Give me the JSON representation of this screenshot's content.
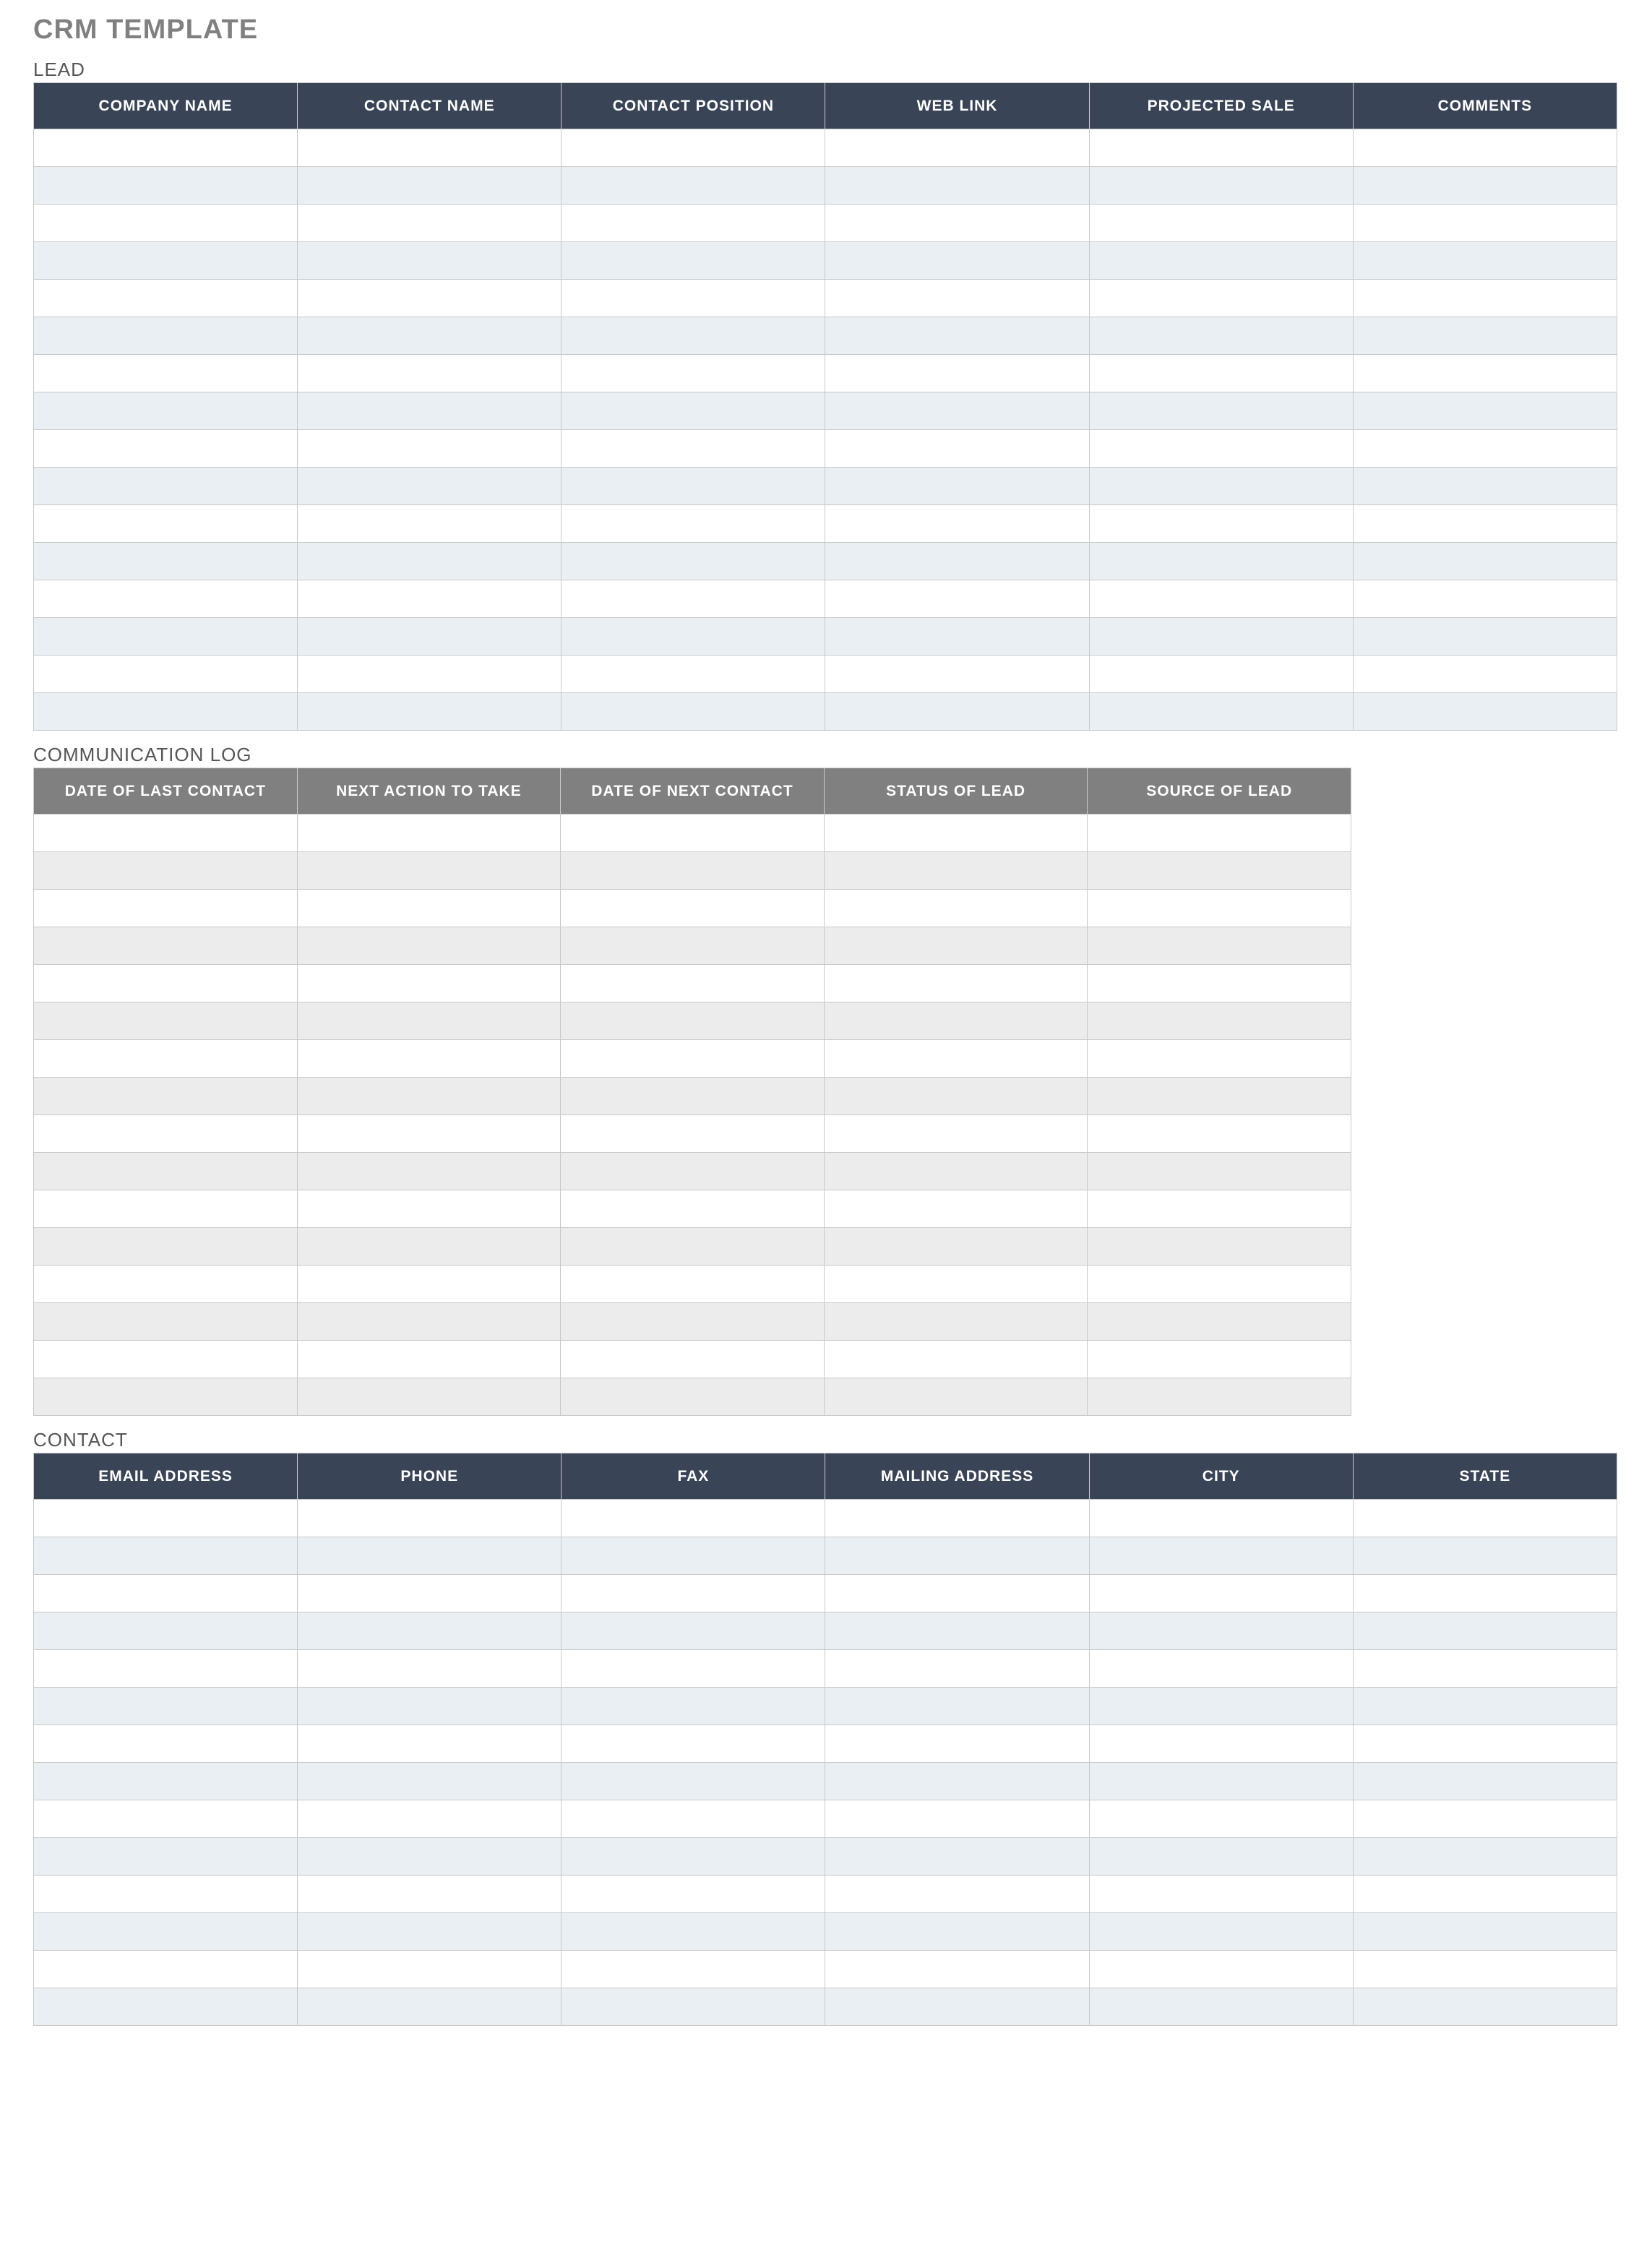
{
  "title": "CRM TEMPLATE",
  "lead": {
    "label": "LEAD",
    "headers": [
      "COMPANY NAME",
      "CONTACT NAME",
      "CONTACT POSITION",
      "WEB LINK",
      "PROJECTED SALE",
      "COMMENTS"
    ],
    "rows": [
      [
        "",
        "",
        "",
        "",
        "",
        ""
      ],
      [
        "",
        "",
        "",
        "",
        "",
        ""
      ],
      [
        "",
        "",
        "",
        "",
        "",
        ""
      ],
      [
        "",
        "",
        "",
        "",
        "",
        ""
      ],
      [
        "",
        "",
        "",
        "",
        "",
        ""
      ],
      [
        "",
        "",
        "",
        "",
        "",
        ""
      ],
      [
        "",
        "",
        "",
        "",
        "",
        ""
      ],
      [
        "",
        "",
        "",
        "",
        "",
        ""
      ],
      [
        "",
        "",
        "",
        "",
        "",
        ""
      ],
      [
        "",
        "",
        "",
        "",
        "",
        ""
      ],
      [
        "",
        "",
        "",
        "",
        "",
        ""
      ],
      [
        "",
        "",
        "",
        "",
        "",
        ""
      ],
      [
        "",
        "",
        "",
        "",
        "",
        ""
      ],
      [
        "",
        "",
        "",
        "",
        "",
        ""
      ],
      [
        "",
        "",
        "",
        "",
        "",
        ""
      ],
      [
        "",
        "",
        "",
        "",
        "",
        ""
      ]
    ]
  },
  "communication_log": {
    "label": "COMMUNICATION LOG",
    "headers": [
      "DATE OF LAST CONTACT",
      "NEXT ACTION TO TAKE",
      "DATE OF NEXT CONTACT",
      "STATUS OF LEAD",
      "SOURCE OF LEAD"
    ],
    "rows": [
      [
        "",
        "",
        "",
        "",
        ""
      ],
      [
        "",
        "",
        "",
        "",
        ""
      ],
      [
        "",
        "",
        "",
        "",
        ""
      ],
      [
        "",
        "",
        "",
        "",
        ""
      ],
      [
        "",
        "",
        "",
        "",
        ""
      ],
      [
        "",
        "",
        "",
        "",
        ""
      ],
      [
        "",
        "",
        "",
        "",
        ""
      ],
      [
        "",
        "",
        "",
        "",
        ""
      ],
      [
        "",
        "",
        "",
        "",
        ""
      ],
      [
        "",
        "",
        "",
        "",
        ""
      ],
      [
        "",
        "",
        "",
        "",
        ""
      ],
      [
        "",
        "",
        "",
        "",
        ""
      ],
      [
        "",
        "",
        "",
        "",
        ""
      ],
      [
        "",
        "",
        "",
        "",
        ""
      ],
      [
        "",
        "",
        "",
        "",
        ""
      ],
      [
        "",
        "",
        "",
        "",
        ""
      ]
    ]
  },
  "contact": {
    "label": "CONTACT",
    "headers": [
      "EMAIL ADDRESS",
      "PHONE",
      "FAX",
      "MAILING ADDRESS",
      "CITY",
      "STATE"
    ],
    "rows": [
      [
        "",
        "",
        "",
        "",
        "",
        ""
      ],
      [
        "",
        "",
        "",
        "",
        "",
        ""
      ],
      [
        "",
        "",
        "",
        "",
        "",
        ""
      ],
      [
        "",
        "",
        "",
        "",
        "",
        ""
      ],
      [
        "",
        "",
        "",
        "",
        "",
        ""
      ],
      [
        "",
        "",
        "",
        "",
        "",
        ""
      ],
      [
        "",
        "",
        "",
        "",
        "",
        ""
      ],
      [
        "",
        "",
        "",
        "",
        "",
        ""
      ],
      [
        "",
        "",
        "",
        "",
        "",
        ""
      ],
      [
        "",
        "",
        "",
        "",
        "",
        ""
      ],
      [
        "",
        "",
        "",
        "",
        "",
        ""
      ],
      [
        "",
        "",
        "",
        "",
        "",
        ""
      ],
      [
        "",
        "",
        "",
        "",
        "",
        ""
      ],
      [
        "",
        "",
        "",
        "",
        "",
        ""
      ]
    ]
  }
}
